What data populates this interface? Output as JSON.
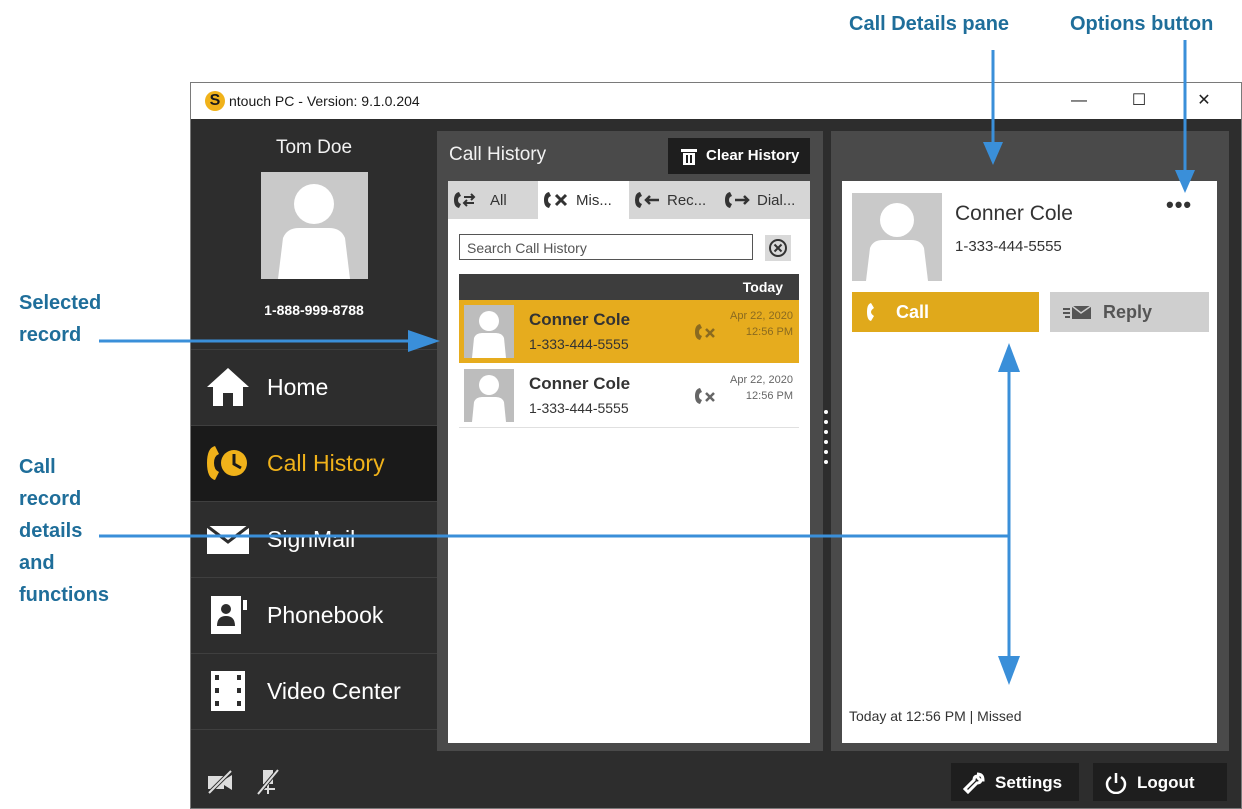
{
  "annotations": {
    "call_details_pane": "Call Details pane",
    "options_button": "Options button",
    "selected_record_line1": "Selected",
    "selected_record_line2": "record",
    "call_record_line1": "Call",
    "call_record_line2": "record",
    "call_record_line3": "details",
    "call_record_line4": "and",
    "call_record_line5": "functions"
  },
  "window": {
    "title": "ntouch PC  -  Version:  9.1.0.204",
    "logo_letter": "S",
    "minimize": "—",
    "maximize": "☐",
    "close": "✕"
  },
  "sidebar": {
    "user_name": "Tom Doe",
    "user_phone": "1-888-999-8788",
    "items": [
      {
        "label": "Home",
        "icon": "home-icon",
        "active": false
      },
      {
        "label": "Call History",
        "icon": "call-history-icon",
        "active": true
      },
      {
        "label": "SignMail",
        "icon": "envelope-icon",
        "active": false
      },
      {
        "label": "Phonebook",
        "icon": "phonebook-icon",
        "active": false
      },
      {
        "label": "Video Center",
        "icon": "film-icon",
        "active": false
      }
    ]
  },
  "call_history": {
    "title": "Call History",
    "clear_label": "Clear History",
    "tabs": [
      {
        "label": "All",
        "icon": "all-calls-icon"
      },
      {
        "label": "Mis...",
        "icon": "missed-call-icon"
      },
      {
        "label": "Rec...",
        "icon": "received-call-icon"
      },
      {
        "label": "Dial...",
        "icon": "dialed-call-icon"
      }
    ],
    "active_tab": "Mis...",
    "search_placeholder": "Search Call History",
    "day_header": "Today",
    "records": [
      {
        "name": "Conner Cole",
        "phone": "1-333-444-5555",
        "date": "Apr 22, 2020",
        "time": "12:56 PM",
        "type": "missed",
        "selected": true
      },
      {
        "name": "Conner Cole",
        "phone": "1-333-444-5555",
        "date": "Apr 22, 2020",
        "time": "12:56 PM",
        "type": "missed",
        "selected": false
      }
    ]
  },
  "details": {
    "name": "Conner Cole",
    "phone": "1-333-444-5555",
    "options_label": "•••",
    "call_label": "Call",
    "reply_label": "Reply",
    "status": "Today at 12:56 PM  |  Missed"
  },
  "bottom": {
    "settings_label": "Settings",
    "logout_label": "Logout"
  },
  "colors": {
    "accent": "#e0a91b",
    "annotation": "#1f6e9a",
    "arrow": "#3a8fd9",
    "dark_bg": "#2d2d2d"
  }
}
